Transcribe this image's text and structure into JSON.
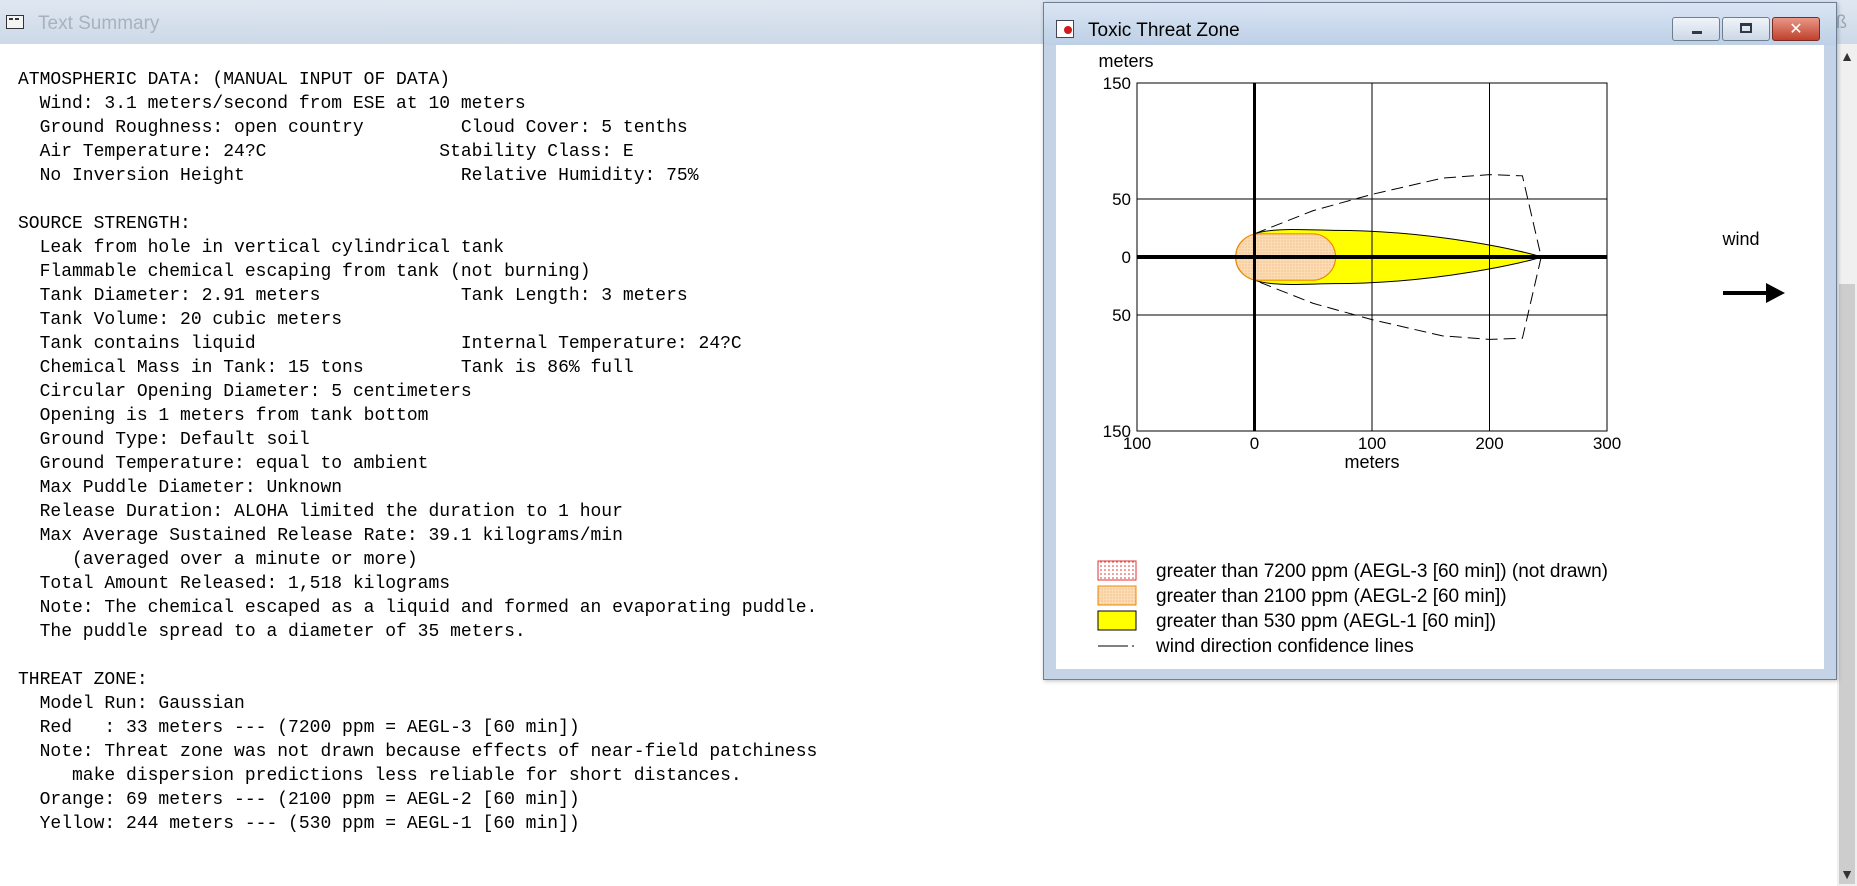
{
  "text_window": {
    "title": "Text Summary",
    "lines": [
      "ATMOSPHERIC DATA: (MANUAL INPUT OF DATA)",
      "  Wind: 3.1 meters/second from ESE at 10 meters",
      "  Ground Roughness: open country         Cloud Cover: 5 tenths",
      "  Air Temperature: 24?C                Stability Class: E",
      "  No Inversion Height                    Relative Humidity: 75%",
      "",
      "SOURCE STRENGTH:",
      "  Leak from hole in vertical cylindrical tank",
      "  Flammable chemical escaping from tank (not burning)",
      "  Tank Diameter: 2.91 meters             Tank Length: 3 meters",
      "  Tank Volume: 20 cubic meters",
      "  Tank contains liquid                   Internal Temperature: 24?C",
      "  Chemical Mass in Tank: 15 tons         Tank is 86% full",
      "  Circular Opening Diameter: 5 centimeters",
      "  Opening is 1 meters from tank bottom",
      "  Ground Type: Default soil",
      "  Ground Temperature: equal to ambient",
      "  Max Puddle Diameter: Unknown",
      "  Release Duration: ALOHA limited the duration to 1 hour",
      "  Max Average Sustained Release Rate: 39.1 kilograms/min",
      "     (averaged over a minute or more)",
      "  Total Amount Released: 1,518 kilograms",
      "  Note: The chemical escaped as a liquid and formed an evaporating puddle.",
      "  The puddle spread to a diameter of 35 meters.",
      "",
      "THREAT ZONE:",
      "  Model Run: Gaussian",
      "  Red   : 33 meters --- (7200 ppm = AEGL-3 [60 min])",
      "  Note: Threat zone was not drawn because effects of near-field patchiness",
      "     make dispersion predictions less reliable for short distances.",
      "  Orange: 69 meters --- (2100 ppm = AEGL-2 [60 min])",
      "  Yellow: 244 meters --- (530 ppm = AEGL-1 [60 min])"
    ]
  },
  "threat_window": {
    "title": "Toxic Threat Zone",
    "buttons": {
      "close_symbol": "✕"
    },
    "wind_label": "wind"
  },
  "chart_data": {
    "type": "area",
    "ylabel": "meters",
    "xlabel": "meters",
    "xlim": [
      -100,
      300
    ],
    "ylim": [
      -150,
      150
    ],
    "x_ticks": [
      -100,
      0,
      100,
      200,
      300
    ],
    "x_tick_labels": [
      "100",
      "0",
      "100",
      "200",
      "300"
    ],
    "y_ticks": [
      150,
      50,
      0,
      -50,
      -150
    ],
    "y_tick_labels": [
      "150",
      "50",
      "0",
      "50",
      "150"
    ],
    "grid": true,
    "colors": {
      "red": "#e03030",
      "orange_fill": "#fbdcb4",
      "orange_edge": "#f08a00",
      "yellow": "#ffff00"
    },
    "zones": [
      {
        "name": "yellow",
        "x_min": -16,
        "x_max": 244,
        "half_width_max": 23
      },
      {
        "name": "orange",
        "x_min": -16,
        "x_max": 69,
        "half_width_max": 20
      }
    ],
    "confidence_lines": {
      "points": [
        [
          0,
          20
        ],
        [
          50,
          40
        ],
        [
          100,
          54
        ],
        [
          160,
          68
        ],
        [
          200,
          71
        ],
        [
          228,
          70
        ],
        [
          244,
          0
        ],
        [
          228,
          -70
        ],
        [
          200,
          -71
        ],
        [
          160,
          -68
        ],
        [
          100,
          -54
        ],
        [
          50,
          -40
        ],
        [
          0,
          -20
        ]
      ]
    },
    "legend": [
      {
        "label": "greater than 7200 ppm (AEGL-3 [60 min]) (not drawn)",
        "swatch": "red-dotted"
      },
      {
        "label": "greater than 2100 ppm (AEGL-2 [60 min])",
        "swatch": "orange"
      },
      {
        "label": "greater than 530 ppm (AEGL-1 [60 min])",
        "swatch": "yellow"
      },
      {
        "label": "wind direction confidence lines",
        "swatch": "dash"
      }
    ]
  }
}
